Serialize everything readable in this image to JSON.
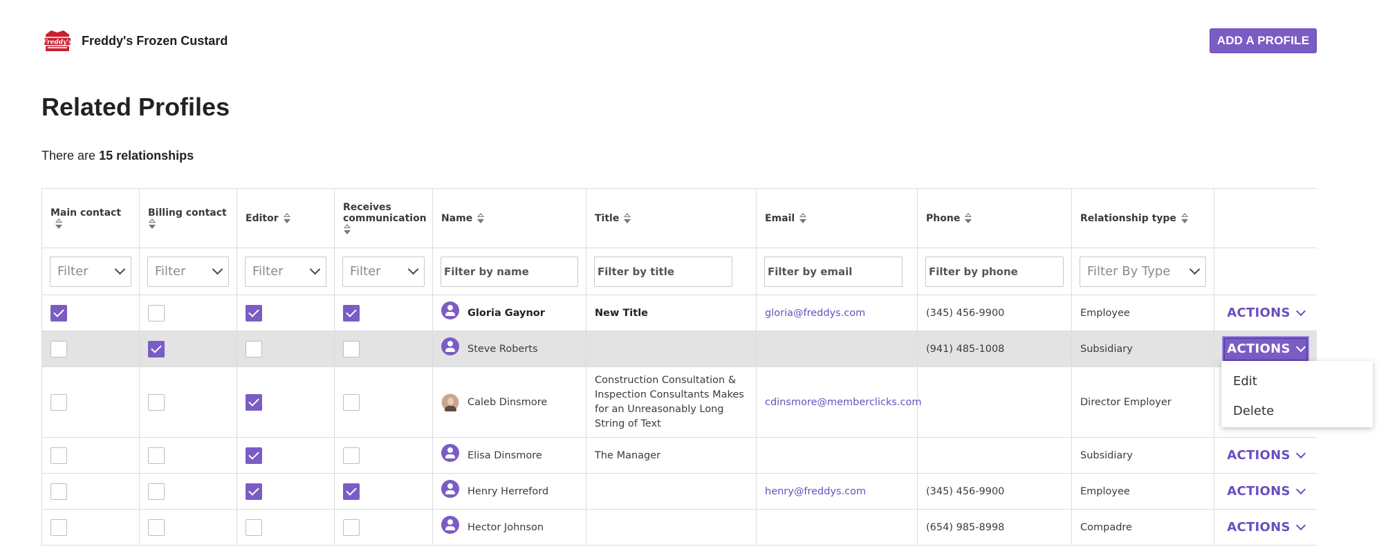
{
  "header": {
    "org_name": "Freddy's Frozen Custard",
    "logo_text": "Freddy's",
    "add_button": "ADD A PROFILE"
  },
  "page": {
    "title": "Related Profiles",
    "summary_prefix": "There are",
    "summary_count": "15 relationships"
  },
  "table": {
    "columns": [
      "Main contact",
      "Billing contact",
      "Editor",
      "Receives communication",
      "Name",
      "Title",
      "Email",
      "Phone",
      "Relationship type",
      ""
    ],
    "filters": {
      "select_placeholder": "Filter",
      "name": "Filter by name",
      "title": "Filter by title",
      "email": "Filter by email",
      "phone": "Filter by phone",
      "type": "Filter By Type"
    },
    "actions_label": "ACTIONS",
    "rows": [
      {
        "main": true,
        "billing": false,
        "editor": true,
        "comm": true,
        "name": "Gloria Gaynor",
        "title": "New Title",
        "email": "gloria@freddys.com",
        "phone": "(345) 456-9900",
        "type": "Employee"
      },
      {
        "main": false,
        "billing": true,
        "editor": false,
        "comm": false,
        "name": "Steve Roberts",
        "title": "",
        "email": "",
        "phone": "(941) 485-1008",
        "type": "Subsidiary"
      },
      {
        "main": false,
        "billing": false,
        "editor": true,
        "comm": false,
        "name": "Caleb Dinsmore",
        "title": "Construction Consultation & Inspection Consultants Makes for an Unreasonably Long String of Text",
        "email": "cdinsmore@memberclicks.com",
        "phone": "",
        "type": "Director Employer"
      },
      {
        "main": false,
        "billing": false,
        "editor": true,
        "comm": false,
        "name": "Elisa Dinsmore",
        "title": "The Manager",
        "email": "",
        "phone": "",
        "type": "Subsidiary"
      },
      {
        "main": false,
        "billing": false,
        "editor": true,
        "comm": true,
        "name": "Henry Herreford",
        "title": "",
        "email": "henry@freddys.com",
        "phone": "(345) 456-9900",
        "type": "Employee"
      },
      {
        "main": false,
        "billing": false,
        "editor": false,
        "comm": false,
        "name": "Hector Johnson",
        "title": "",
        "email": "",
        "phone": "(654) 985-8998",
        "type": "Compadre"
      }
    ]
  },
  "dropdown": {
    "items": [
      "Edit",
      "Delete"
    ]
  },
  "colors": {
    "accent": "#7b5cc4",
    "link": "#6a4fbf",
    "highlight_row": "#e3e3e3"
  }
}
